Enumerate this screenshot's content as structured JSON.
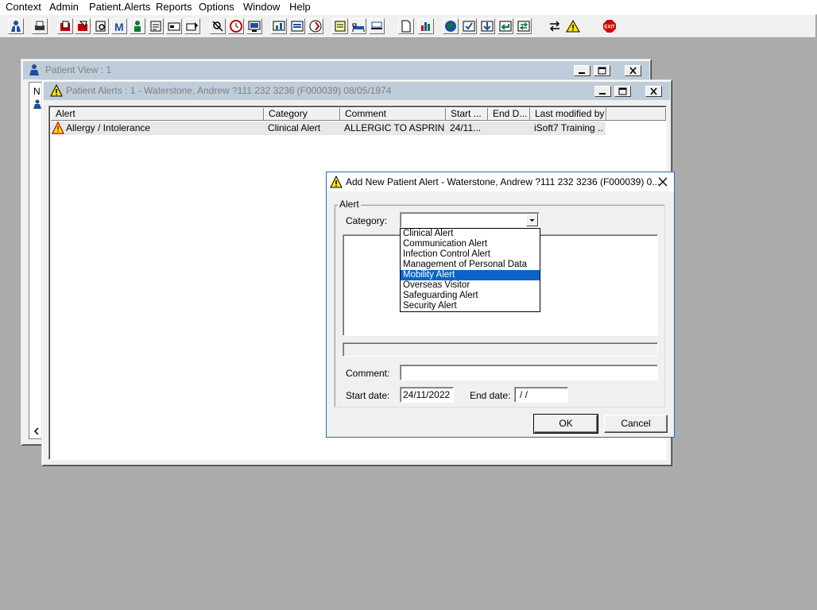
{
  "menubar": [
    "Context",
    "Admin",
    "Patient.Alerts",
    "Reports",
    "Options",
    "Window",
    "Help"
  ],
  "patient_view": {
    "title": "Patient View : 1",
    "fragment_text": "N"
  },
  "patient_alerts": {
    "title": "Patient Alerts : 1 - Waterstone, Andrew ?111 232 3236 (F000039) 08/05/1974",
    "columns": [
      "Alert",
      "Category",
      "Comment",
      "Start ...",
      "End D...",
      "Last modified by"
    ],
    "rows": [
      {
        "alert": "Allergy / Intolerance",
        "category": "Clinical Alert",
        "comment": "ALLERGIC TO ASPRIN",
        "start": "24/11...",
        "end": "",
        "modified_by": "iSoft7 Training ..."
      }
    ]
  },
  "dialog": {
    "title": "Add New Patient Alert - Waterstone, Andrew ?111 232 3236 (F000039) 0...",
    "group_label": "Alert",
    "category_label": "Category:",
    "category_value": "",
    "category_options": [
      "Clinical Alert",
      "Communication Alert",
      "Infection Control Alert",
      "Management of Personal Data",
      "Mobility Alert",
      "Overseas Visitor",
      "Safeguarding Alert",
      "Security Alert"
    ],
    "selected_option": "Mobility Alert",
    "comment_label": "Comment:",
    "comment_value": "",
    "start_label": "Start date:",
    "start_value": "24/11/2022",
    "end_label": "End date:",
    "end_value": " /  /",
    "ok_label": "OK",
    "cancel_label": "Cancel"
  },
  "icons": {
    "toolbar": [
      "patient-icon",
      "printer-icon",
      "folder-icon",
      "edit-folder-icon",
      "search-doc-icon",
      "letter-m-icon",
      "person-icon",
      "notepad-icon",
      "card-icon",
      "card-arrow-icon",
      "no-search-icon",
      "clock-icon",
      "monitor-icon",
      "chart-icon",
      "list-icon",
      "globe-icon",
      "note-icon",
      "bed-icon",
      "stretcher-icon",
      "document-icon",
      "bar-chart-icon",
      "world-icon",
      "check-icon",
      "arrow-down-icon",
      "arrow-return-icon",
      "transfer-icon",
      "warning-icon",
      "exit-icon"
    ],
    "exit_color": "#d40000",
    "warning_color": "#ffe600"
  }
}
